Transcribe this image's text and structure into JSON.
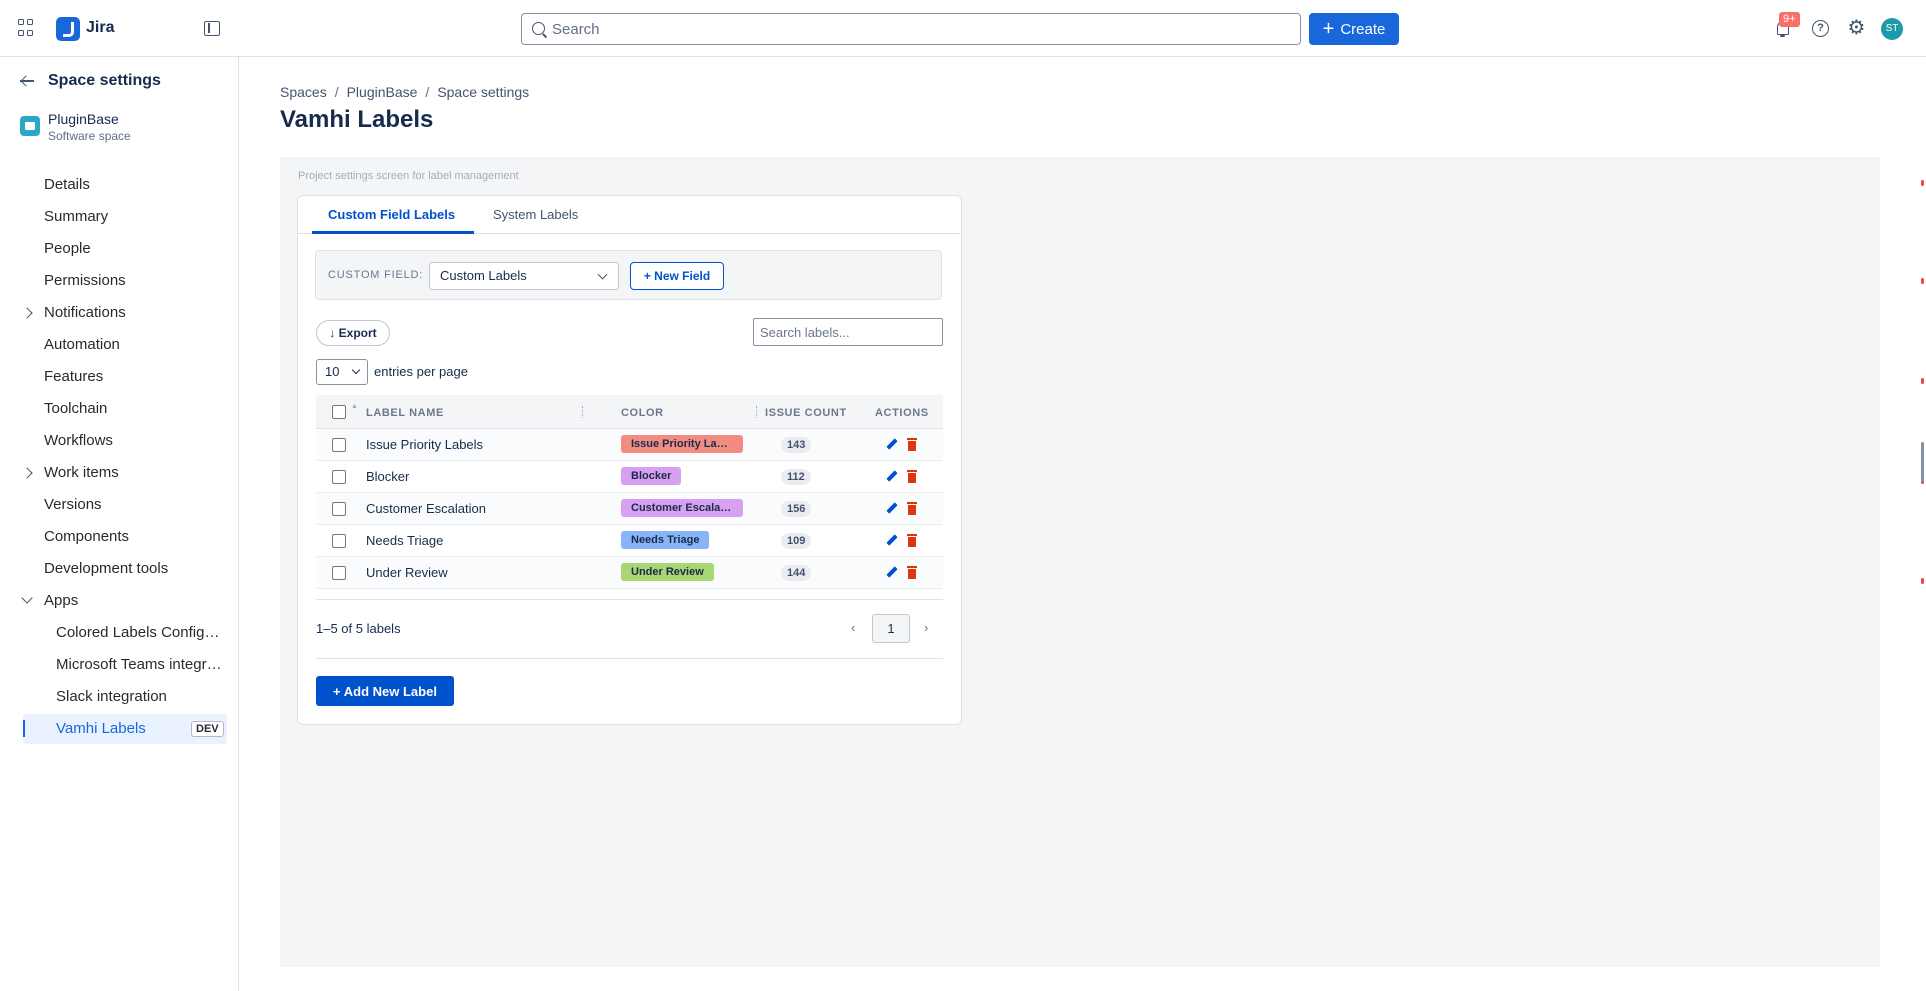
{
  "topbar": {
    "app_name": "Jira",
    "search_placeholder": "Search",
    "create_label": "Create",
    "notification_badge": "9+",
    "help_glyph": "?",
    "settings_glyph": "⚙",
    "avatar_initials": "ST"
  },
  "sidebar": {
    "title": "Space settings",
    "project": {
      "name": "PluginBase",
      "type": "Software space"
    },
    "items": [
      {
        "label": "Details"
      },
      {
        "label": "Summary"
      },
      {
        "label": "People"
      },
      {
        "label": "Permissions"
      },
      {
        "label": "Notifications",
        "expandable": true
      },
      {
        "label": "Automation"
      },
      {
        "label": "Features"
      },
      {
        "label": "Toolchain"
      },
      {
        "label": "Workflows"
      },
      {
        "label": "Work items",
        "expandable": true
      },
      {
        "label": "Versions"
      },
      {
        "label": "Components"
      },
      {
        "label": "Development tools"
      },
      {
        "label": "Apps",
        "expanded": true
      }
    ],
    "apps": [
      {
        "label": "Colored Labels Configuration"
      },
      {
        "label": "Microsoft Teams integration"
      },
      {
        "label": "Slack integration"
      }
    ],
    "active_app": {
      "label": "Vamhi Labels",
      "tag": "DEV"
    }
  },
  "breadcrumb": [
    "Spaces",
    "PluginBase",
    "Space settings"
  ],
  "breadcrumb_sep": "/",
  "page_title": "Vamhi Labels",
  "content": {
    "hint": "Project settings screen for label management",
    "tabs": [
      "Custom Field Labels",
      "System Labels"
    ],
    "custom_field_label": "CUSTOM FIELD:",
    "custom_field_value": "Custom Labels",
    "new_field_label": "+ New Field",
    "export_label": "↓ Export",
    "search_placeholder": "Search labels...",
    "entries_value": "10",
    "entries_label": "entries per page",
    "columns": [
      "LABEL NAME",
      "COLOR",
      "ISSUE COUNT",
      "ACTIONS"
    ],
    "rows": [
      {
        "name": "Issue Priority Labels",
        "color_label": "Issue Priority Labels",
        "color": "#f28b82",
        "count": "143"
      },
      {
        "name": "Blocker",
        "color_label": "Blocker",
        "color": "#d7a0f0",
        "count": "112"
      },
      {
        "name": "Customer Escalation",
        "color_label": "Customer Escalation",
        "color": "#d7a0f0",
        "count": "156"
      },
      {
        "name": "Needs Triage",
        "color_label": "Needs Triage",
        "color": "#8ab4f8",
        "count": "109"
      },
      {
        "name": "Under Review",
        "color_label": "Under Review",
        "color": "#a8d672",
        "count": "144"
      }
    ],
    "pager_summary": "1–5 of 5 labels",
    "pager_prev": "‹",
    "pager_current": "1",
    "pager_next": "›",
    "add_label": "+ Add New Label"
  }
}
